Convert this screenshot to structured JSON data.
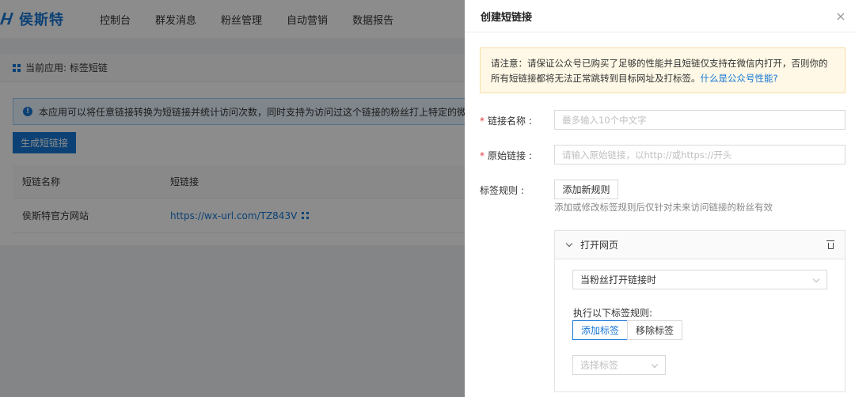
{
  "app": {
    "logo_text": "侯斯特",
    "nav": [
      "控制台",
      "群发消息",
      "粉丝管理",
      "自动营销",
      "数据报告"
    ],
    "breadcrumb": "当前应用: 标签短链",
    "notice": "本应用可以将任意链接转换为短链接并统计访问次数，同时支持为访问过这个链接的粉丝打上特定的微信标签以",
    "generate_button": "生成短链接",
    "table": {
      "columns": [
        "短链名称",
        "短链接"
      ],
      "rows": [
        {
          "name": "侯斯特官方网站",
          "link": "https://wx-url.com/TZ843V"
        }
      ]
    }
  },
  "drawer": {
    "title": "创建短链接",
    "close_label": "×",
    "warning_text": "请注意：请保证公众号已购买了足够的性能并且短链仅支持在微信内打开，否则你的所有短链接都将无法正常跳转到目标网址及打标签。",
    "warning_link": "什么是公众号性能?",
    "fields": {
      "name_label": "链接名称 :",
      "name_value": "",
      "name_placeholder": "最多输入10个中文字",
      "url_label": "原始链接 :",
      "url_value": "",
      "url_placeholder": "请输入原始链接，以http://或https://开头",
      "required_mark": "*"
    },
    "tag_rules": {
      "label": "标签规则 :",
      "add_rule_button": "添加新规则",
      "hint": "添加或修改标签规则后仅针对未来访问链接的粉丝有效",
      "rule": {
        "title": "打开网页",
        "trigger_value": "当粉丝打开链接时",
        "exec_label": "执行以下标签规则:",
        "add_tag_button": "添加标签",
        "remove_tag_button": "移除标签",
        "tag_select_placeholder": "选择标签"
      }
    }
  },
  "colors": {
    "accent": "#1677d6",
    "required": "#e0393e",
    "warning_bg": "#fff8e6"
  }
}
